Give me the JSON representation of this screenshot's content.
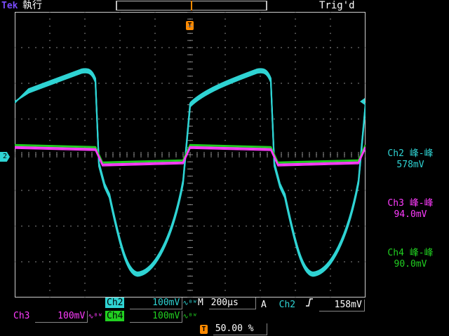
{
  "topbar": {
    "brand": "Tek",
    "mode": "執行",
    "trigger_status": "Trig'd"
  },
  "markers": {
    "trigger_top": "T",
    "trigger_bottom": "T",
    "ch2_ground": "2"
  },
  "measurements": [
    {
      "channel": "Ch2",
      "label": "Ch2 峰-峰",
      "value": "578mV",
      "color": "#2fd4d4"
    },
    {
      "channel": "Ch3",
      "label": "Ch3 峰-峰",
      "value": "94.0mV",
      "color": "#ff3cff"
    },
    {
      "channel": "Ch4",
      "label": "Ch4 峰-峰",
      "value": "90.0mV",
      "color": "#21d021"
    }
  ],
  "bottom": {
    "ch2": {
      "name": "Ch2",
      "scale": "100mV",
      "coupling": "∿ᴮᵂ"
    },
    "ch3": {
      "name": "Ch3",
      "scale": "100mV",
      "coupling": "∿ᴮᵂ"
    },
    "ch4": {
      "name": "Ch4",
      "scale": "100mV",
      "coupling": "∿ᴮᵂ"
    },
    "timebase": {
      "prefix": "M",
      "value": "200µs"
    },
    "trigger": {
      "mode": "A",
      "source": "Ch2",
      "slope_icon": "rising-edge-icon",
      "level": "158mV"
    },
    "position": {
      "marker": "T",
      "value": "50.00 %"
    }
  },
  "colors": {
    "ch2": "#2fd4d4",
    "ch3": "#ff3cff",
    "ch4": "#21d021",
    "trigger": "#ff8a00",
    "brand": "#7a4cff"
  }
}
